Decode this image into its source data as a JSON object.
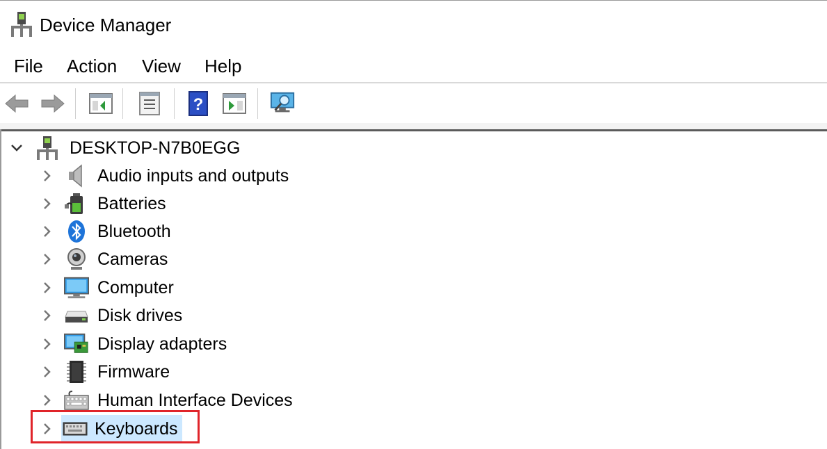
{
  "window": {
    "title": "Device Manager",
    "icon": "device-manager-icon"
  },
  "menubar": {
    "items": [
      {
        "id": "file",
        "label": "File"
      },
      {
        "id": "action",
        "label": "Action"
      },
      {
        "id": "view",
        "label": "View"
      },
      {
        "id": "help",
        "label": "Help"
      }
    ]
  },
  "toolbar": {
    "buttons": [
      "back-arrow-icon",
      "forward-arrow-icon",
      "show-hide-console-tree-icon",
      "properties-icon",
      "help-icon",
      "run-action-icon",
      "scan-hardware-changes-icon"
    ]
  },
  "tree": {
    "root": {
      "label": "DESKTOP-N7B0EGG",
      "expanded": true,
      "icon": "computer-network-icon"
    },
    "children": [
      {
        "label": "Audio inputs and outputs",
        "icon": "speaker-icon"
      },
      {
        "label": "Batteries",
        "icon": "battery-plug-icon"
      },
      {
        "label": "Bluetooth",
        "icon": "bluetooth-icon"
      },
      {
        "label": "Cameras",
        "icon": "webcam-icon"
      },
      {
        "label": "Computer",
        "icon": "monitor-icon"
      },
      {
        "label": "Disk drives",
        "icon": "disk-drive-icon"
      },
      {
        "label": "Display adapters",
        "icon": "display-adapter-icon"
      },
      {
        "label": "Firmware",
        "icon": "chip-icon"
      },
      {
        "label": "Human Interface Devices",
        "icon": "hid-keyboard-icon"
      },
      {
        "label": "Keyboards",
        "icon": "keyboard-icon",
        "selected": true
      }
    ]
  },
  "colors": {
    "selection": "#cce8ff",
    "highlight_box": "#e0242a"
  }
}
